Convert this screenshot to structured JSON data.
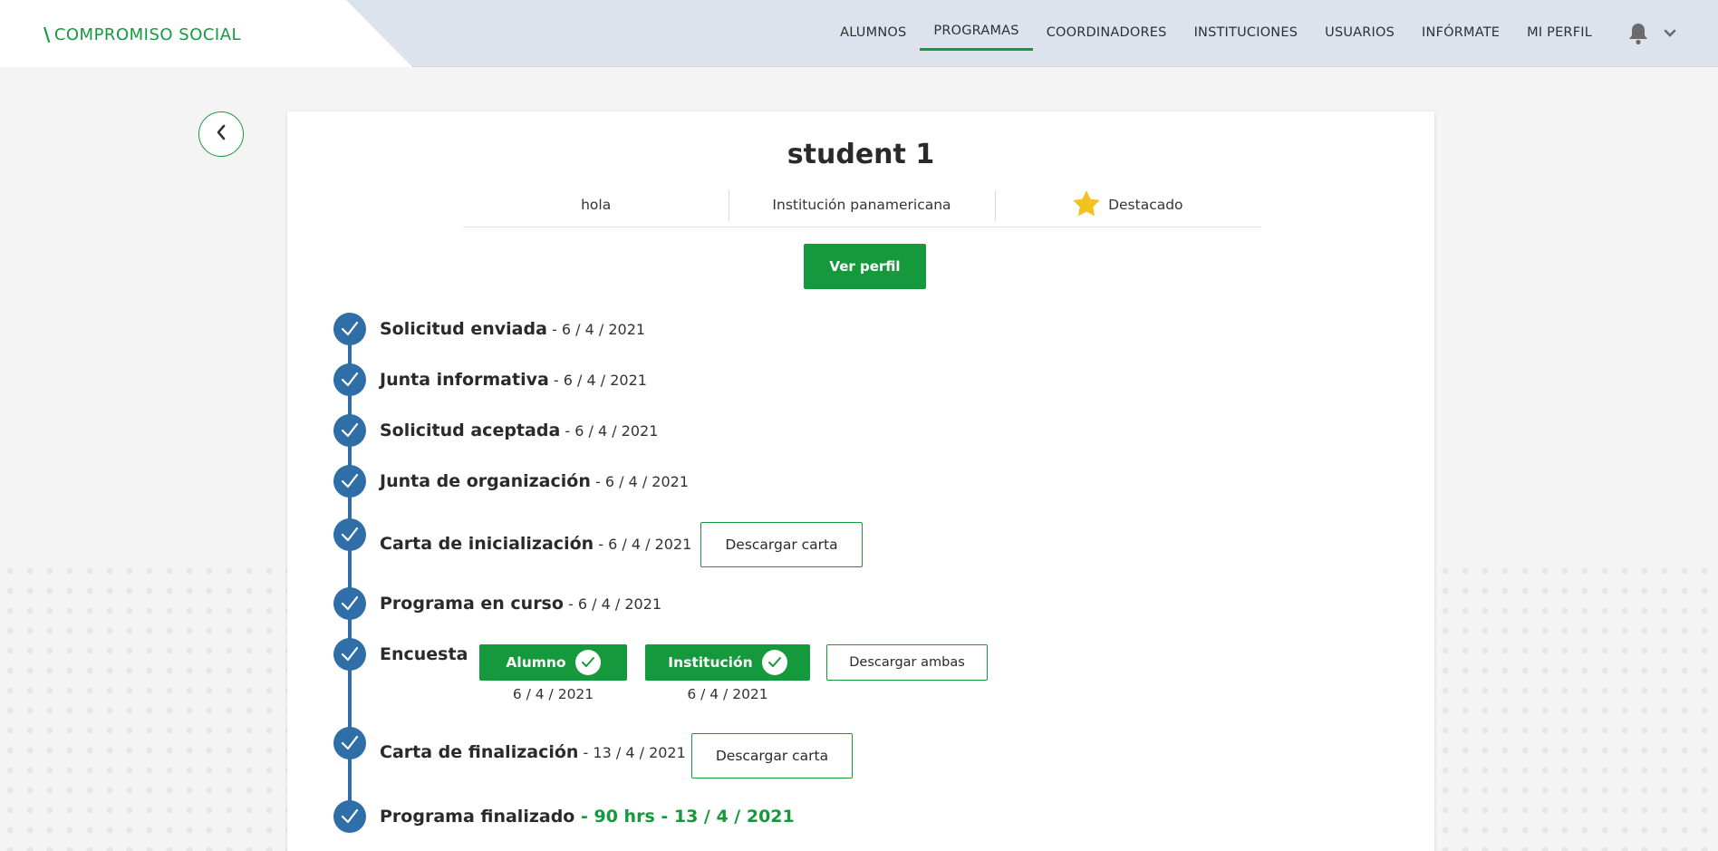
{
  "header": {
    "logo_mark": "\\",
    "logo_text": "COMPROMISO SOCIAL",
    "nav": [
      {
        "label": "ALUMNOS",
        "active": false
      },
      {
        "label": "PROGRAMAS",
        "active": true
      },
      {
        "label": "COORDINADORES",
        "active": false
      },
      {
        "label": "INSTITUCIONES",
        "active": false
      },
      {
        "label": "USUARIOS",
        "active": false
      },
      {
        "label": "INFÓRMATE",
        "active": false
      },
      {
        "label": "MI PERFIL",
        "active": false
      }
    ],
    "icons": {
      "notifications": "bell-icon",
      "menu": "chevron-down-icon"
    }
  },
  "back_icon": "chevron-left-icon",
  "student": {
    "name": "student 1",
    "info": [
      "hola",
      "Institución panamericana",
      "Destacado"
    ],
    "featured_icon": "star-icon",
    "view_profile_label": "Ver perfil"
  },
  "timeline": {
    "steps": [
      {
        "title": "Solicitud enviada",
        "date": " - 6 / 4 / 2021"
      },
      {
        "title": "Junta informativa",
        "date": " - 6 / 4 / 2021"
      },
      {
        "title": "Solicitud aceptada",
        "date": " - 6 / 4 / 2021"
      },
      {
        "title": "Junta de organización",
        "date": " - 6 / 4 / 2021"
      },
      {
        "title": "Carta de inicialización",
        "date": " - 6 / 4 / 2021",
        "button": "Descargar carta"
      },
      {
        "title": "Programa en curso",
        "date": " - 6 / 4 / 2021"
      },
      {
        "title": "Encuesta",
        "date": ""
      },
      {
        "title": "Carta de finalización",
        "date": " - 13 / 4 / 2021",
        "button": "Descargar carta"
      },
      {
        "title": "Programa finalizado",
        "date": " - 90 hrs - 13 / 4 / 2021"
      }
    ],
    "survey": {
      "alumno_label": "Alumno",
      "alumno_date": "6 / 4 / 2021",
      "institucion_label": "Institución",
      "institucion_date": "6 / 4 / 2021",
      "download_both_label": "Descargar ambas"
    }
  },
  "colors": {
    "brand_green": "#149a3c",
    "timeline_blue": "#2f6ea7",
    "star_yellow": "#f2c31c",
    "header_bg": "#dde3ed"
  }
}
